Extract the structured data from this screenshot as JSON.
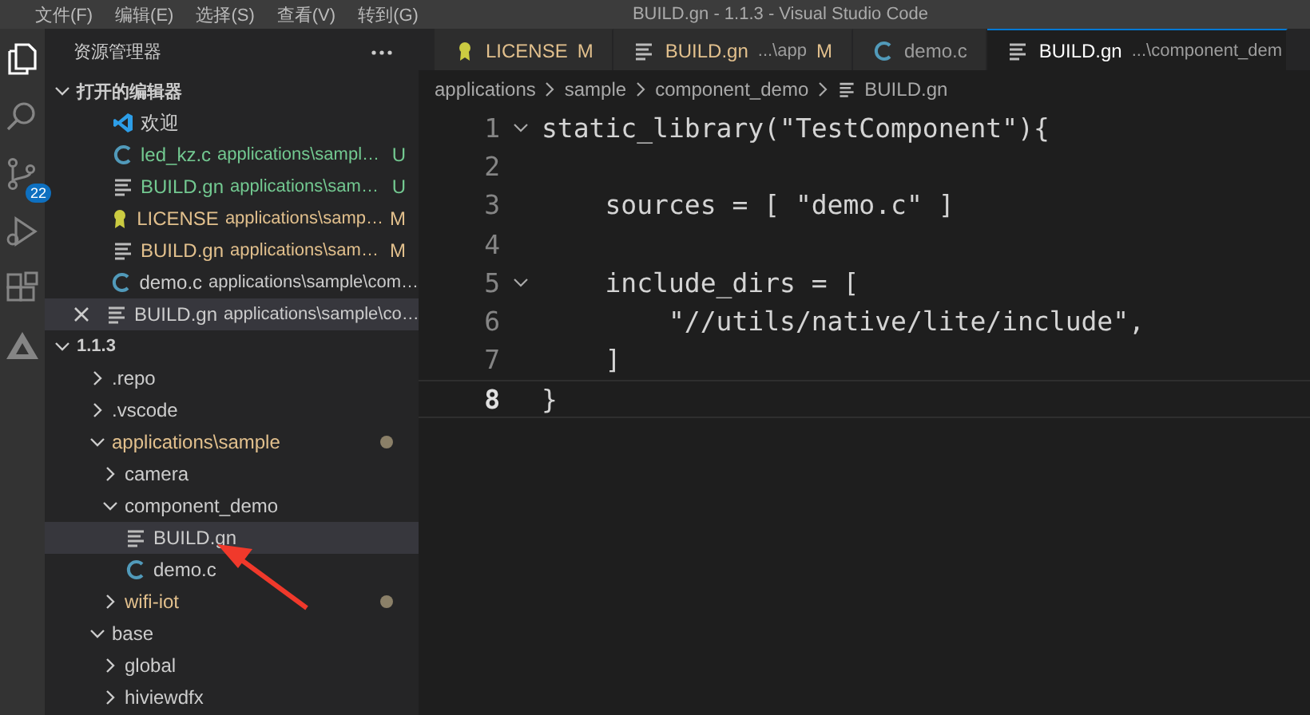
{
  "menu": [
    "文件(F)",
    "编辑(E)",
    "选择(S)",
    "查看(V)",
    "转到(G)"
  ],
  "window": {
    "title": "BUILD.gn - 1.1.3 - Visual Studio Code"
  },
  "activity_bar": {
    "items": [
      {
        "kind": "explorer",
        "selected": true
      },
      {
        "kind": "search",
        "selected": false
      },
      {
        "kind": "source-control",
        "selected": false,
        "badge": "22"
      },
      {
        "kind": "run",
        "selected": false
      },
      {
        "kind": "extensions",
        "selected": false
      },
      {
        "kind": "triangle",
        "selected": false
      }
    ]
  },
  "explorer": {
    "title": "资源管理器",
    "open_editors": {
      "label": "打开的编辑器",
      "expanded": true,
      "items": [
        {
          "kind": "vscode",
          "name": "欢迎",
          "color": "#cccccc",
          "selected": false
        },
        {
          "kind": "c",
          "name": "led_kz.c",
          "path": "applications\\sampl…",
          "status": "U",
          "color": "#73c991",
          "selected": false
        },
        {
          "kind": "gn",
          "name": "BUILD.gn",
          "path": "applications\\sam…",
          "status": "U",
          "color": "#73c991",
          "selected": false
        },
        {
          "kind": "license",
          "name": "LICENSE",
          "path": "applications\\samp…",
          "status": "M",
          "color": "#e2c08d",
          "selected": false
        },
        {
          "kind": "gn",
          "name": "BUILD.gn",
          "path": "applications\\sam…",
          "status": "M",
          "color": "#e2c08d",
          "selected": false
        },
        {
          "kind": "c",
          "name": "demo.c",
          "path": "applications\\sample\\com…",
          "color": "#cccccc",
          "selected": false
        },
        {
          "kind": "gn",
          "name": "BUILD.gn",
          "path": "applications\\sample\\co…",
          "color": "#cccccc",
          "selected": true
        }
      ]
    },
    "tree": {
      "label": "1.1.3",
      "expanded": true,
      "children": [
        {
          "name": ".repo",
          "kind": "folder",
          "expanded": false,
          "modified": false,
          "selected": false
        },
        {
          "name": ".vscode",
          "kind": "folder",
          "expanded": false,
          "modified": false,
          "selected": false
        },
        {
          "name": "applications\\sample",
          "kind": "folder",
          "expanded": true,
          "modified": true,
          "selected": false,
          "children": [
            {
              "name": "camera",
              "kind": "folder",
              "expanded": false,
              "modified": false,
              "selected": false
            },
            {
              "name": "component_demo",
              "kind": "folder",
              "expanded": true,
              "modified": false,
              "selected": false,
              "children": [
                {
                  "name": "BUILD.gn",
                  "kind": "gn",
                  "modified": false,
                  "selected": true
                },
                {
                  "name": "demo.c",
                  "kind": "c",
                  "modified": false,
                  "selected": false
                }
              ]
            },
            {
              "name": "wifi-iot",
              "kind": "folder",
              "expanded": false,
              "modified": true,
              "selected": false
            }
          ]
        },
        {
          "name": "base",
          "kind": "folder",
          "expanded": true,
          "modified": false,
          "selected": false,
          "children": [
            {
              "name": "global",
              "kind": "folder",
              "expanded": false,
              "modified": false,
              "selected": false
            },
            {
              "name": "hiviewdfx",
              "kind": "folder",
              "expanded": false,
              "modified": false,
              "selected": false
            }
          ]
        }
      ]
    }
  },
  "tabs": [
    {
      "kind": "license",
      "name": "LICENSE",
      "status": "M",
      "color": "#e2c08d",
      "selected": false
    },
    {
      "kind": "gn",
      "name": "BUILD.gn",
      "description": "...\\app",
      "status": "M",
      "color": "#e2c08d",
      "selected": false
    },
    {
      "kind": "c",
      "name": "demo.c",
      "color": "#9d9d9d",
      "selected": false
    },
    {
      "kind": "gn",
      "name": "BUILD.gn",
      "description": "...\\component_dem",
      "color": "#ffffff",
      "selected": true
    }
  ],
  "breadcrumb": [
    "applications",
    "sample",
    "component_demo",
    "BUILD.gn"
  ],
  "code": [
    {
      "number": "1",
      "text": "static_library(\"TestComponent\"){",
      "fold": true,
      "current": false
    },
    {
      "number": "2",
      "fold": false,
      "current": false
    },
    {
      "number": "3",
      "text": "    sources = [ \"demo.c\" ]",
      "fold": false,
      "current": false
    },
    {
      "number": "4",
      "fold": false,
      "current": false
    },
    {
      "number": "5",
      "text": "    include_dirs = [",
      "fold": true,
      "current": false
    },
    {
      "number": "6",
      "text": "        \"//utils/native/lite/include\",",
      "fold": false,
      "current": false
    },
    {
      "number": "7",
      "text": "    ]",
      "fold": false,
      "current": false
    },
    {
      "number": "8",
      "text": "}",
      "fold": false,
      "current": true
    }
  ]
}
